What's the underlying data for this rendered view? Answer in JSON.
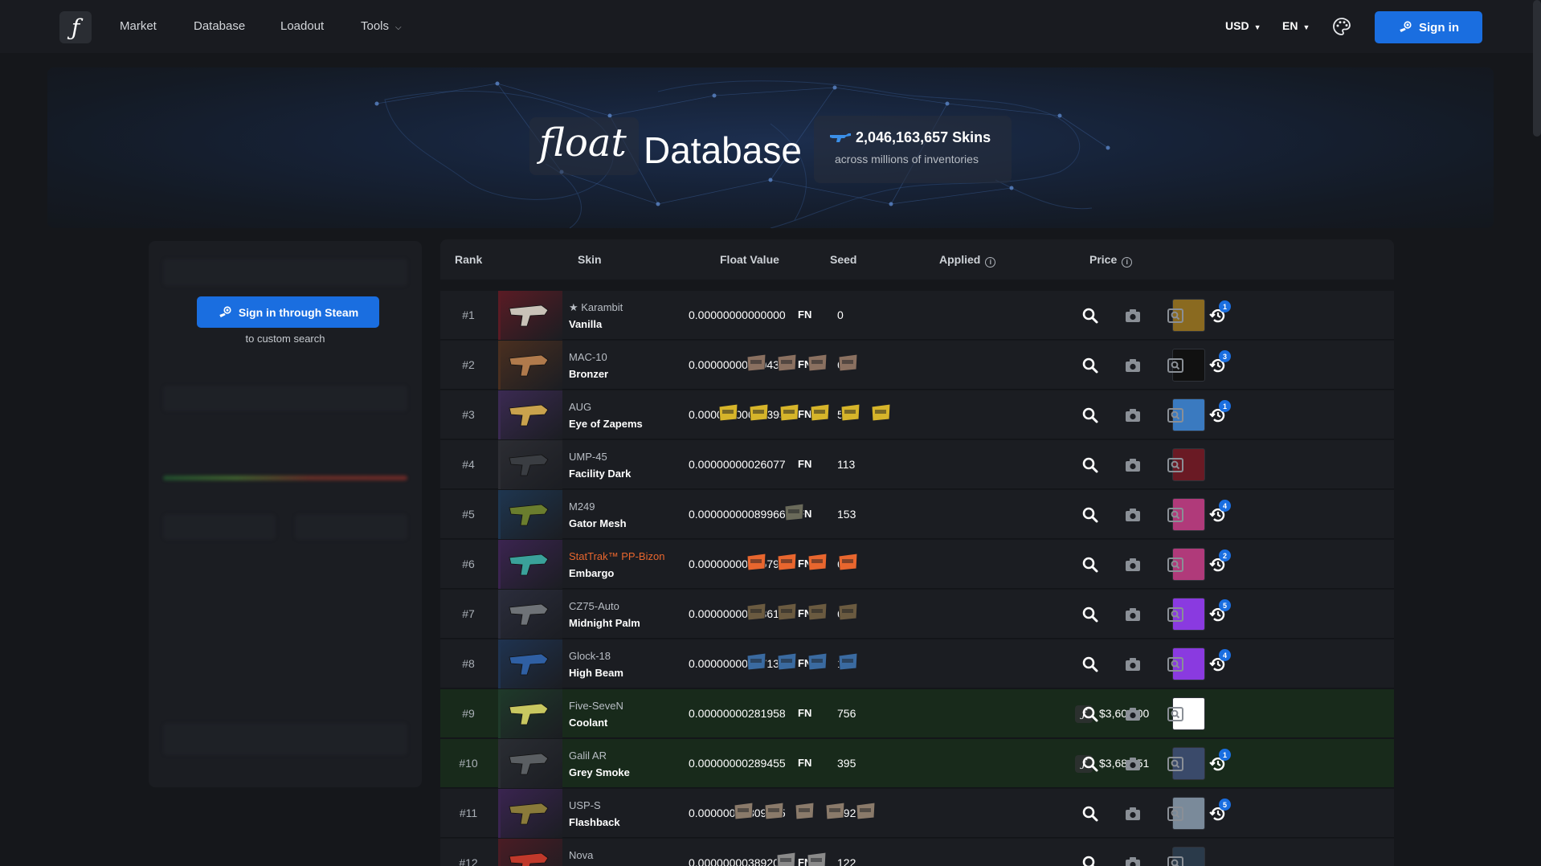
{
  "nav": {
    "items": [
      {
        "label": "Market"
      },
      {
        "label": "Database"
      },
      {
        "label": "Loadout"
      },
      {
        "label": "Tools"
      }
    ],
    "currency": "USD",
    "language": "EN",
    "sign_in": "Sign in"
  },
  "hero": {
    "brand": "float",
    "title": "Database",
    "skins_count": "2,046,163,657 Skins",
    "skins_sub": "across millions of inventories"
  },
  "sidebar": {
    "steam_button": "Sign in through Steam",
    "steam_sub": "to custom search"
  },
  "table": {
    "headers": {
      "rank": "Rank",
      "skin": "Skin",
      "float": "Float Value",
      "seed": "Seed",
      "applied": "Applied",
      "price": "Price"
    },
    "rows": [
      {
        "rank": "#1",
        "type": "★ Karambit",
        "name": "Vanilla",
        "float": "0.00000000000000",
        "wear": "FN",
        "seed": "0",
        "price": "",
        "badge": "1",
        "stattrak": false,
        "green": false
      },
      {
        "rank": "#2",
        "type": "MAC-10",
        "name": "Bronzer",
        "float": "0.00000000010431",
        "wear": "FN",
        "seed": "673",
        "price": "",
        "badge": "3",
        "stattrak": false,
        "green": false
      },
      {
        "rank": "#3",
        "type": "AUG",
        "name": "Eye of Zapems",
        "float": "0.00000000019395",
        "wear": "FN",
        "seed": "532",
        "price": "",
        "badge": "1",
        "stattrak": false,
        "green": false
      },
      {
        "rank": "#4",
        "type": "UMP-45",
        "name": "Facility Dark",
        "float": "0.00000000026077",
        "wear": "FN",
        "seed": "113",
        "price": "",
        "badge": "",
        "stattrak": false,
        "green": false
      },
      {
        "rank": "#5",
        "type": "M249",
        "name": "Gator Mesh",
        "float": "0.00000000089966",
        "wear": "FN",
        "seed": "153",
        "price": "",
        "badge": "4",
        "stattrak": false,
        "green": false
      },
      {
        "rank": "#6",
        "type": "StatTrak™ PP-Bizon",
        "name": "Embargo",
        "float": "0.00000000185799",
        "wear": "FN",
        "seed": "603",
        "price": "",
        "badge": "2",
        "stattrak": true,
        "green": false
      },
      {
        "rank": "#7",
        "type": "CZ75-Auto",
        "name": "Midnight Palm",
        "float": "0.00000000208616",
        "wear": "FN",
        "seed": "650",
        "price": "",
        "badge": "5",
        "stattrak": false,
        "green": false
      },
      {
        "rank": "#8",
        "type": "Glock-18",
        "name": "High Beam",
        "float": "0.00000000227131",
        "wear": "FN",
        "seed": "192",
        "price": "",
        "badge": "4",
        "stattrak": false,
        "green": false
      },
      {
        "rank": "#9",
        "type": "Five-SeveN",
        "name": "Coolant",
        "float": "0.00000000281958",
        "wear": "FN",
        "seed": "756",
        "price": "$3,600.00",
        "badge": "",
        "stattrak": false,
        "green": true
      },
      {
        "rank": "#10",
        "type": "Galil AR",
        "name": "Grey Smoke",
        "float": "0.00000000289455",
        "wear": "FN",
        "seed": "395",
        "price": "$3,684.51",
        "badge": "1",
        "stattrak": false,
        "green": true
      },
      {
        "rank": "#11",
        "type": "USP-S",
        "name": "Flashback",
        "float": "0.00000000309665",
        "wear": "FN",
        "seed": "992",
        "price": "",
        "badge": "5",
        "stattrak": false,
        "green": false
      },
      {
        "rank": "#12",
        "type": "Nova",
        "name": "",
        "float": "0.00000000389200",
        "wear": "FN",
        "seed": "122",
        "price": "",
        "badge": "",
        "stattrak": false,
        "green": false
      }
    ]
  },
  "colors": {
    "accent": "#1a6ee0",
    "stattrak": "#e8662e",
    "background": "#15171b",
    "row": "#1b1d22",
    "row_priced": "#182a1b"
  }
}
